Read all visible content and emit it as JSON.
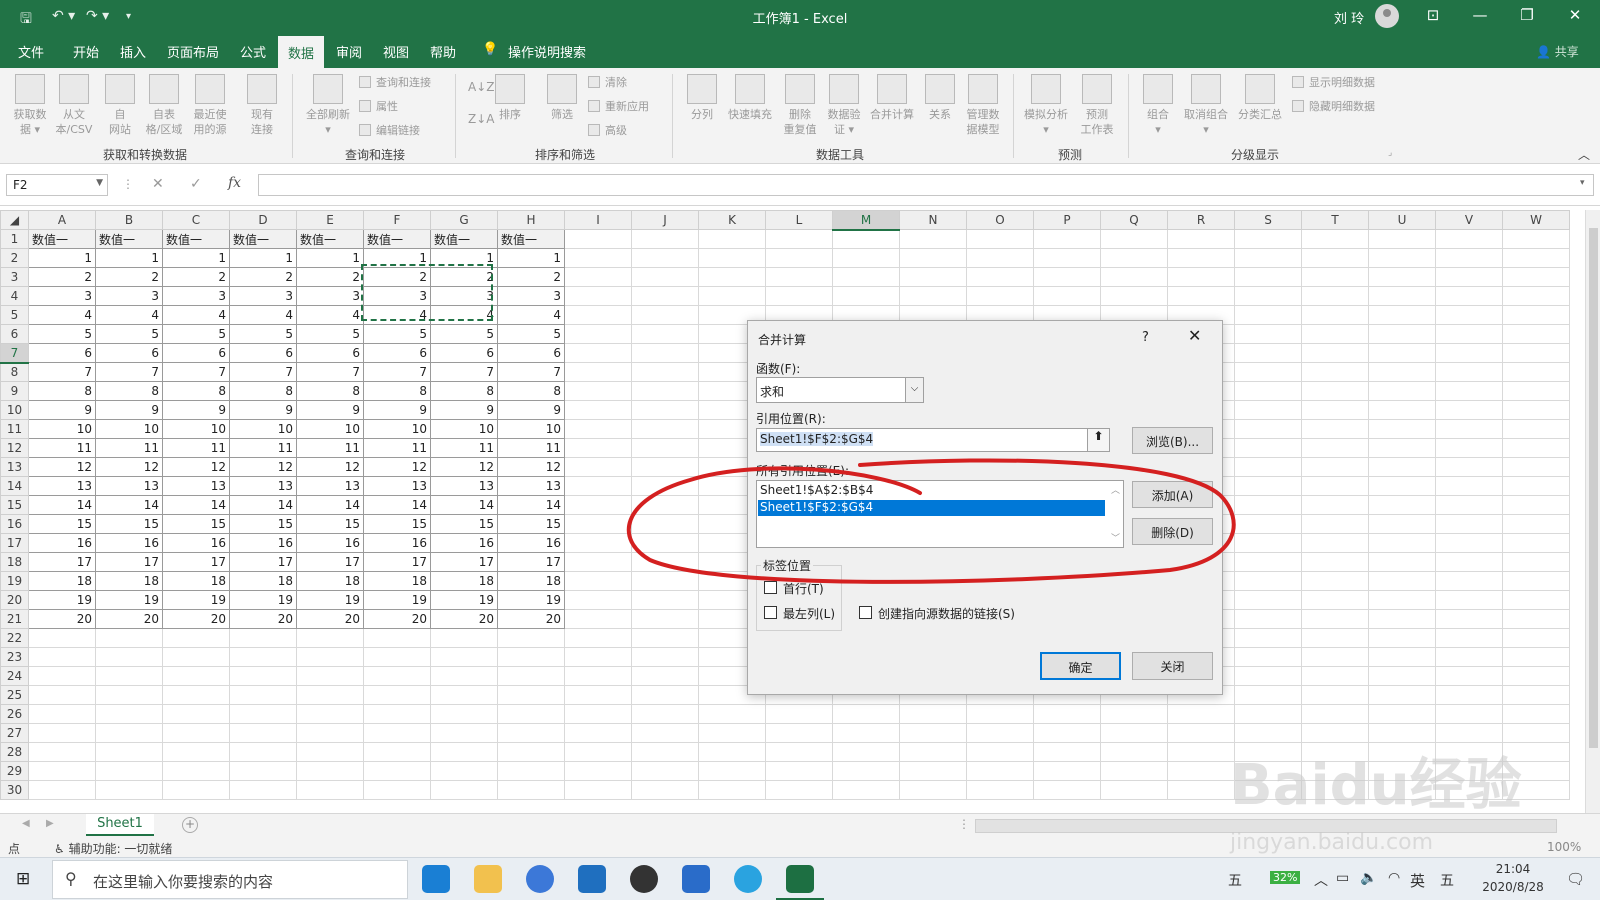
{
  "titlebar": {
    "title": "工作簿1  -  Excel",
    "user": "刘 玲",
    "icons": [
      "save-icon",
      "undo-icon",
      "redo-icon",
      "customize-icon",
      "ribbon-display-icon",
      "minimize-icon",
      "restore-icon",
      "close-icon"
    ]
  },
  "menu": {
    "tabs": [
      "文件",
      "开始",
      "插入",
      "页面布局",
      "公式",
      "数据",
      "审阅",
      "视图",
      "帮助"
    ],
    "active": "数据",
    "tell_me": "操作说明搜索",
    "share": "共享"
  },
  "ribbon": {
    "groups": [
      {
        "label": "获取和转换数据",
        "buttons": [
          "获取数\n据 ▾",
          "从文\n本/CSV",
          "自\n网站",
          "自表\n格/区域",
          "最近使\n用的源",
          "现有\n连接"
        ]
      },
      {
        "label": "查询和连接",
        "buttons": [
          "全部刷新\n▾"
        ],
        "small": [
          "查询和连接",
          "属性",
          "编辑链接"
        ]
      },
      {
        "label": "排序和筛选",
        "buttons": [
          "排序",
          "筛选"
        ],
        "small": [
          "清除",
          "重新应用",
          "高级"
        ]
      },
      {
        "label": "数据工具",
        "buttons": [
          "分列",
          "快速填充",
          "删除\n重复值",
          "数据验\n证 ▾",
          "合并计算",
          "关系",
          "管理数\n据模型"
        ]
      },
      {
        "label": "预测",
        "buttons": [
          "模拟分析\n▾",
          "预测\n工作表"
        ]
      },
      {
        "label": "分级显示",
        "buttons": [
          "组合\n▾",
          "取消组合\n▾",
          "分类汇总"
        ],
        "small": [
          "显示明细数据",
          "隐藏明细数据"
        ]
      }
    ],
    "sort_icons": [
      "A↓Z",
      "Z↓A"
    ]
  },
  "formula_bar": {
    "name_box": "F2",
    "formula": "",
    "cancel": "✕",
    "enter": "✓",
    "fx": "fx"
  },
  "sheet": {
    "columns": [
      "A",
      "B",
      "C",
      "D",
      "E",
      "F",
      "G",
      "H",
      "I",
      "J",
      "K",
      "L",
      "M",
      "N",
      "O",
      "P",
      "Q",
      "R",
      "S",
      "T",
      "U",
      "V",
      "W"
    ],
    "selected_column": "M",
    "selected_row": "7",
    "header_row": [
      "数值一",
      "数值一",
      "数值一",
      "数值一",
      "数值一",
      "数值一",
      "数值一",
      "数值一"
    ],
    "data_rows": [
      1,
      2,
      3,
      4,
      5,
      6,
      7,
      8,
      9,
      10,
      11,
      12,
      13,
      14,
      15,
      16,
      17,
      18,
      19,
      20
    ],
    "total_rows": 30,
    "copy_range": "F2:G4"
  },
  "sheet_tabs": {
    "active": "Sheet1"
  },
  "status": {
    "mode": "点",
    "accessibility": "辅助功能: 一切就绪",
    "zoom": "100%"
  },
  "taskbar": {
    "search_placeholder": "在这里输入你要搜索的内容",
    "battery": "32%",
    "ime_lang": "英",
    "ime_mode": "五",
    "ime_left": "五",
    "time": "21:04",
    "date": "2020/8/28"
  },
  "dialog": {
    "title": "合并计算",
    "help": "?",
    "close": "✕",
    "function_label": "函数(F):",
    "function_value": "求和",
    "reference_label": "引用位置(R):",
    "reference_value": "Sheet1!$F$2:$G$4",
    "browse": "浏览(B)...",
    "all_refs_label": "所有引用位置(E):",
    "all_refs": [
      "Sheet1!$A$2:$B$4",
      "Sheet1!$F$2:$G$4"
    ],
    "selected_ref_index": 1,
    "add": "添加(A)",
    "delete": "删除(D)",
    "label_group": "标签位置",
    "first_row": "首行(T)",
    "left_column": "最左列(L)",
    "create_links": "创建指向源数据的链接(S)",
    "ok": "确定",
    "close_button": "关闭",
    "colors": {
      "selection": "#0078d7",
      "annotation": "#d42020"
    }
  },
  "watermark": {
    "logo": "Baidu经验",
    "url": "jingyan.baidu.com"
  }
}
